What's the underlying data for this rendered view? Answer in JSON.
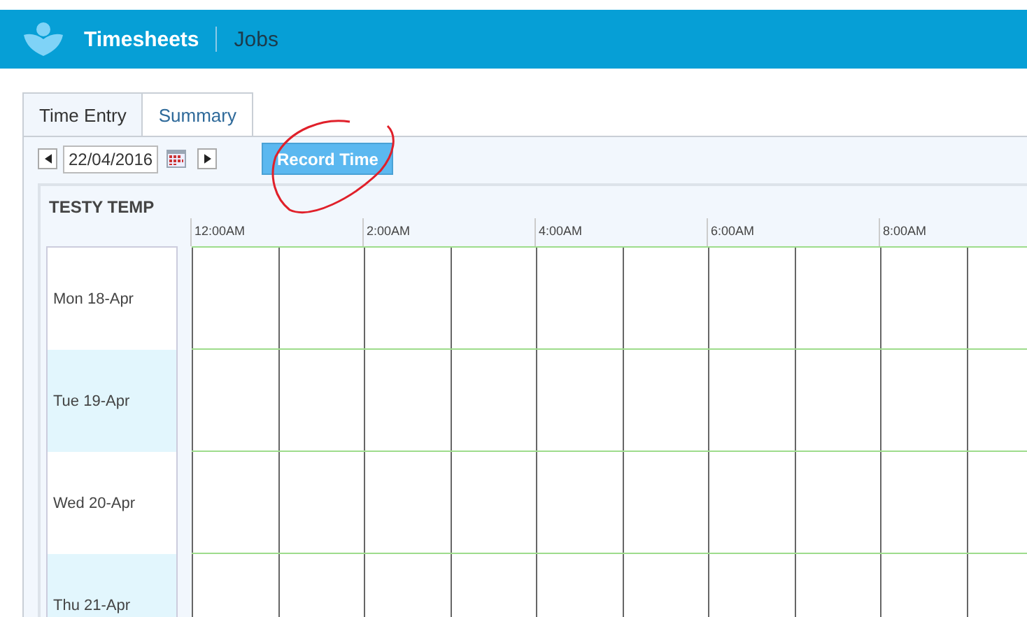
{
  "header": {
    "app_title": "Timesheets",
    "nav_link": "Jobs"
  },
  "tabs": [
    {
      "label": "Time Entry",
      "selected": true
    },
    {
      "label": "Summary",
      "selected": false
    }
  ],
  "toolbar": {
    "date": "22/04/2016",
    "record_button": "Record Time"
  },
  "schedule": {
    "employee": "TESTY TEMP",
    "hours": [
      "12:00AM",
      "2:00AM",
      "4:00AM",
      "6:00AM",
      "8:00AM"
    ],
    "days": [
      {
        "label": "Mon 18-Apr"
      },
      {
        "label": "Tue 19-Apr"
      },
      {
        "label": "Wed 20-Apr"
      },
      {
        "label": "Thu 21-Apr"
      }
    ]
  }
}
